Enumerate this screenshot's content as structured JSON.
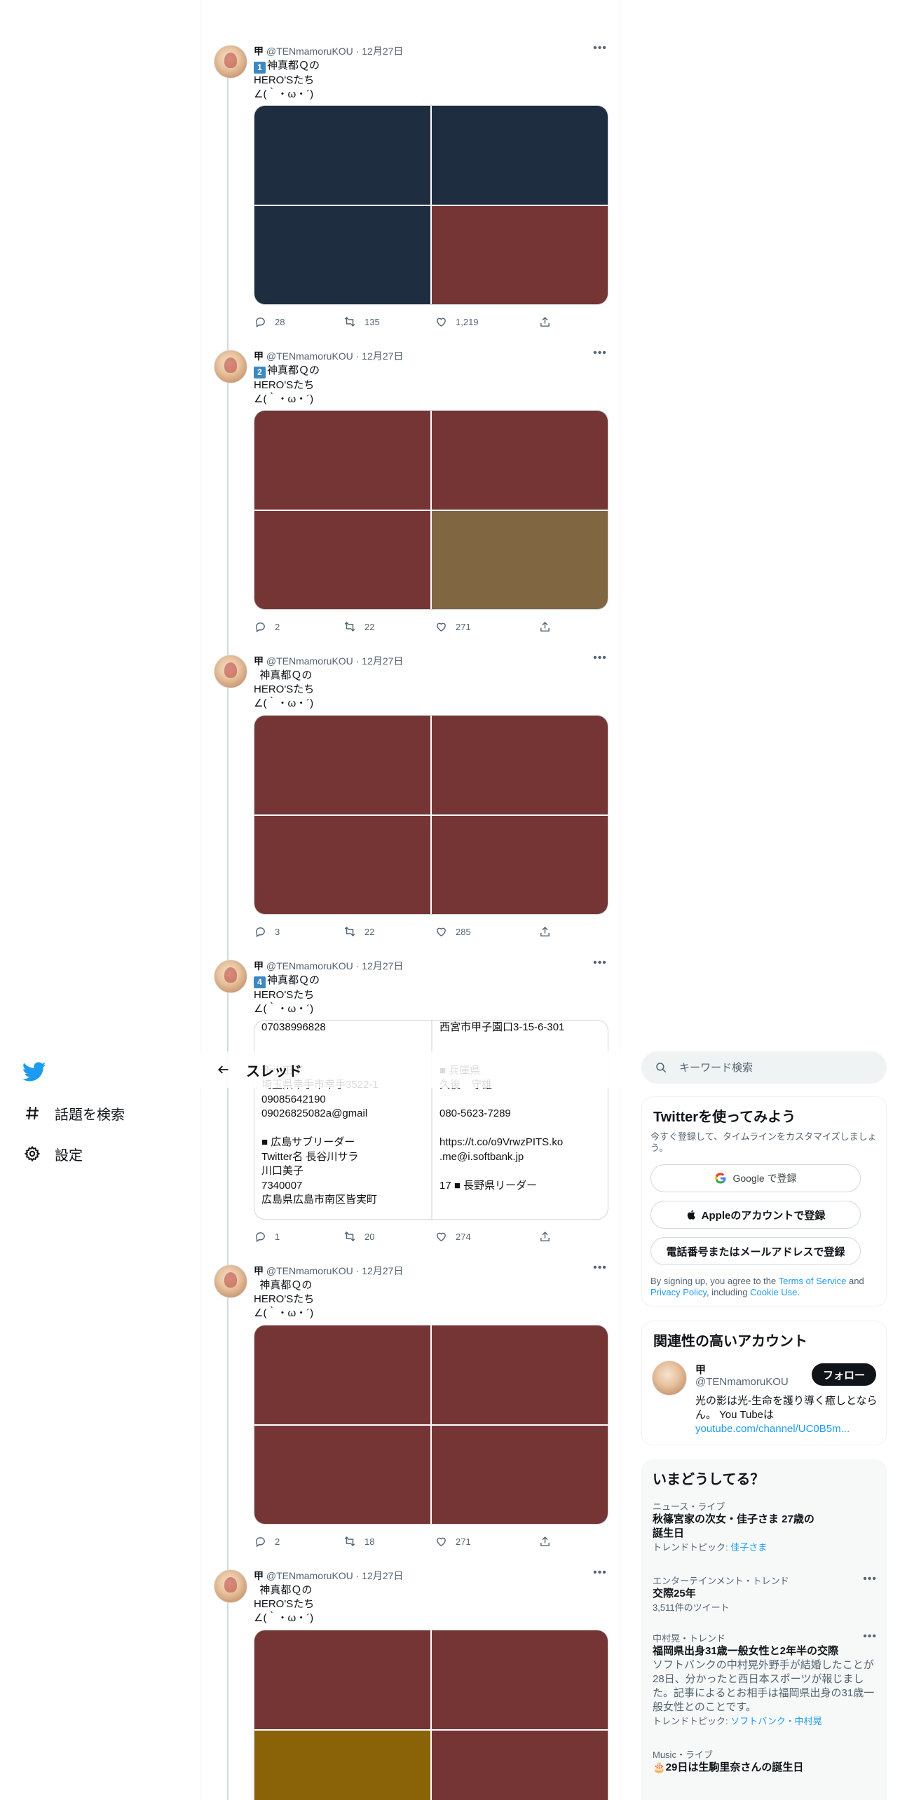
{
  "nav": {
    "items": [
      {
        "label": "話題を検索"
      },
      {
        "label": "設定"
      }
    ]
  },
  "header": {
    "title": "スレッド"
  },
  "tweets": [
    {
      "name": "甲",
      "handle": "@TENmamoruKOU",
      "date": "12月27日",
      "badge": "1",
      "text": "神真都Ｑの\nHERO'Sたち\n∠(｀・ω・´)",
      "replies": "28",
      "retweets": "135",
      "likes": "1,219",
      "media_colors": [
        "#1f2d40",
        "#1f2d40",
        "#1f2d40",
        "#753535"
      ]
    },
    {
      "name": "甲",
      "handle": "@TENmamoruKOU",
      "date": "12月27日",
      "badge": "2",
      "text": "神真都Ｑの\nHERO'Sたち\n∠(｀・ω・´)",
      "replies": "2",
      "retweets": "22",
      "likes": "271",
      "media_colors": [
        "#753535",
        "#753535",
        "#753535",
        "#816642"
      ]
    },
    {
      "name": "甲",
      "handle": "@TENmamoruKOU",
      "date": "12月27日",
      "badge": "",
      "text": "  神真都Ｑの\nHERO'Sたち\n∠(｀・ω・´)",
      "replies": "3",
      "retweets": "22",
      "likes": "285",
      "media_colors": [
        "#753535",
        "#753535",
        "#753535",
        "#753535"
      ]
    },
    {
      "name": "甲",
      "handle": "@TENmamoruKOU",
      "date": "12月27日",
      "badge": "4",
      "text": "神真都Ｑの\nHERO'Sたち\n∠(｀・ω・´)",
      "replies": "1",
      "retweets": "20",
      "likes": "274",
      "media_text_left": "07038996828\n\n\n新小田子\n埼玉県幸手市幸手3522-1\n09085642190\n09026825082a@gmail\n\n■ 広島サブリーダー\nTwitter名 長谷川サラ\n川口美子\n7340007\n広島県広島市南区皆実町",
      "media_text_right": "西宮市甲子園口3-15-6-301\n\n\n■ 兵庫県\n久後　守雄\n\n080-5623-7289\n\nhttps://t.co/o9VrwzPITS.ko\n.me@i.softbank.jp\n\n17 ■ 長野県リーダー"
    },
    {
      "name": "甲",
      "handle": "@TENmamoruKOU",
      "date": "12月27日",
      "badge": "",
      "text": "  神真都Ｑの\nHERO'Sたち\n∠(｀・ω・´)",
      "replies": "2",
      "retweets": "18",
      "likes": "271",
      "media_colors": [
        "#753535",
        "#753535",
        "#753535",
        "#753535"
      ]
    },
    {
      "name": "甲",
      "handle": "@TENmamoruKOU",
      "date": "12月27日",
      "badge": "",
      "text": "  神真都Ｑの\nHERO'Sたち\n∠(｀・ω・´)",
      "media_colors": [
        "#753535",
        "#753535",
        "#8a6208",
        "#753535"
      ]
    }
  ],
  "search": {
    "placeholder": "キーワード検索"
  },
  "signup": {
    "title": "Twitterを使ってみよう",
    "subtitle": "今すぐ登録して、タイムラインをカスタマイズしましょう。",
    "google": "Google で登録",
    "apple": "Appleのアカウントで登録",
    "phone": "電話番号またはメールアドレスで登録",
    "terms_prefix": "By signing up, you agree to the ",
    "terms_link": "Terms of Service",
    "terms_and": " and ",
    "privacy_link": "Privacy Policy",
    "including": ", including ",
    "cookie_link": "Cookie Use",
    "period": "."
  },
  "related": {
    "title": "関連性の高いアカウント",
    "name": "甲",
    "handle": "@TENmamoruKOU",
    "follow": "フォロー",
    "bio": "光の影は光-生命を護り導く癒しとならん。 You Tubeは",
    "bio_link": "youtube.com/channel/UC0B5m..."
  },
  "trends": {
    "title": "いまどうしてる？",
    "items": [
      {
        "category": "ニュース・ライブ",
        "title": "秋篠宮家の次女・佳子さま 27歳の\n誕生日",
        "meta_prefix": "トレンドトピック: ",
        "meta_link": "佳子さま"
      },
      {
        "category": "エンターテインメント・トレンド",
        "title": "交際25年",
        "meta": "3,511件のツイート"
      },
      {
        "category": "中村晃・トレンド",
        "title": "福岡県出身31歳一般女性と2年半の交際",
        "desc": "ソフトバンクの中村晃外野手が結婚したことが28日、分かったと西日本スポーツが報じました。記事によるとお相手は福岡県出身の31歳一般女性とのことです。",
        "meta_prefix": "トレンドトピック: ",
        "meta_link": "ソフトバンク・中村晃"
      },
      {
        "category": "Music・ライブ",
        "title": "🎂29日は生駒里奈さんの誕生日"
      }
    ]
  }
}
